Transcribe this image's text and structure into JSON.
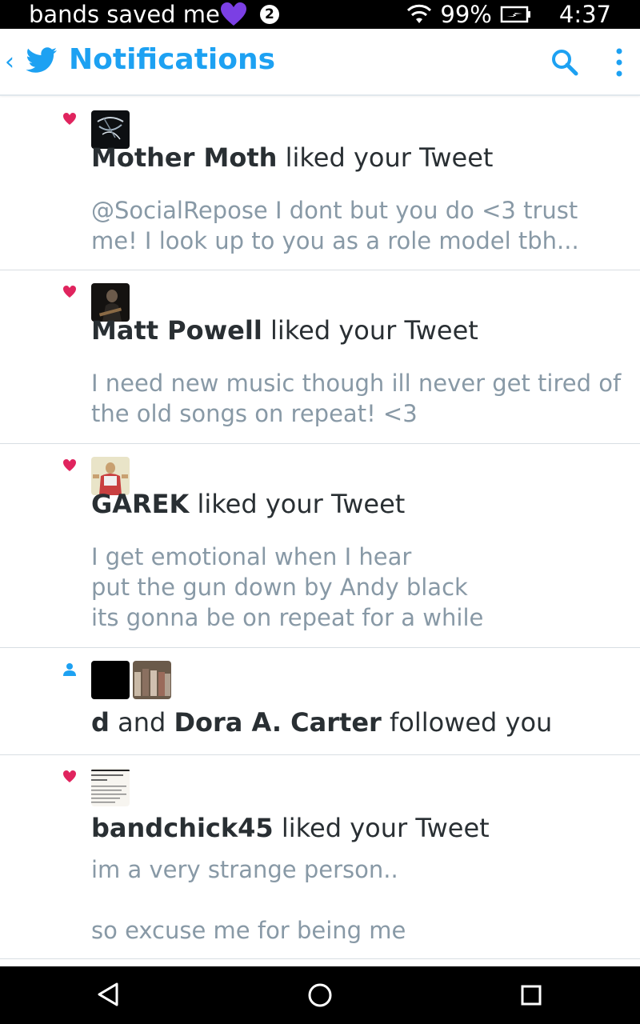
{
  "status_bar": {
    "app_text": "bands saved me",
    "notif_count": "2",
    "battery": "99%",
    "time": "4:37"
  },
  "header": {
    "title": "Notifications"
  },
  "colors": {
    "accent": "#1da1f2",
    "like": "#e0245e",
    "text": "#292f33",
    "subtext": "#8899a6"
  },
  "notifications": [
    {
      "type": "like",
      "icon": "heart-icon",
      "actors": [
        "Mother Moth"
      ],
      "action": " liked your Tweet",
      "text": "@SocialRepose I dont but you do <3 trust me! I look up to you as a role model tbh..."
    },
    {
      "type": "like",
      "icon": "heart-icon",
      "actors": [
        "Matt Powell"
      ],
      "action": " liked your Tweet",
      "text": "I need new music though ill never get tired of the old songs on repeat! <3"
    },
    {
      "type": "like",
      "icon": "heart-icon",
      "actors": [
        "GAREK"
      ],
      "action": " liked your Tweet",
      "text": "I get emotional when I hear\nput the gun down by Andy black\nits gonna be on repeat for a while"
    },
    {
      "type": "follow",
      "icon": "person-icon",
      "actors": [
        "d",
        "Dora A. Carter"
      ],
      "connector": " and ",
      "action": " followed you",
      "text": ""
    },
    {
      "type": "like",
      "icon": "heart-icon",
      "actors": [
        "bandchick45"
      ],
      "action": " liked your Tweet",
      "text": "im a very strange person..\n\nso excuse me for being me"
    }
  ]
}
